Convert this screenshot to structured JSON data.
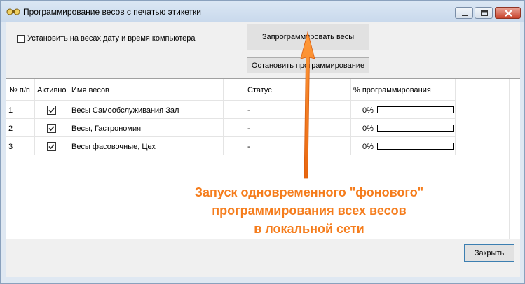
{
  "window": {
    "title": "Программирование весов с печатью этикетки"
  },
  "options": {
    "sync_datetime_label": "Установить на весах дату и время компьютера",
    "sync_datetime_checked": false
  },
  "buttons": {
    "program_label": "Запрограммировать весы",
    "stop_label": "Остановить программирование",
    "close_label": "Закрыть"
  },
  "table": {
    "headers": [
      "№ п/п",
      "Активно",
      "Имя весов",
      "",
      "Статус",
      "% программирования"
    ],
    "rows": [
      {
        "num": "1",
        "active": true,
        "name": "Весы Самообслуживания Зал",
        "status": "-",
        "percent": "0%",
        "progress": 0
      },
      {
        "num": "2",
        "active": true,
        "name": "Весы, Гастрономия",
        "status": "-",
        "percent": "0%",
        "progress": 0
      },
      {
        "num": "3",
        "active": true,
        "name": "Весы фасовочные, Цех",
        "status": "-",
        "percent": "0%",
        "progress": 0
      }
    ]
  },
  "annotation": {
    "line1": "Запуск одновременного \"фонового\"",
    "line2": "программирования всех весов",
    "line3": "в локальной сети",
    "color": "#f57d1d"
  }
}
